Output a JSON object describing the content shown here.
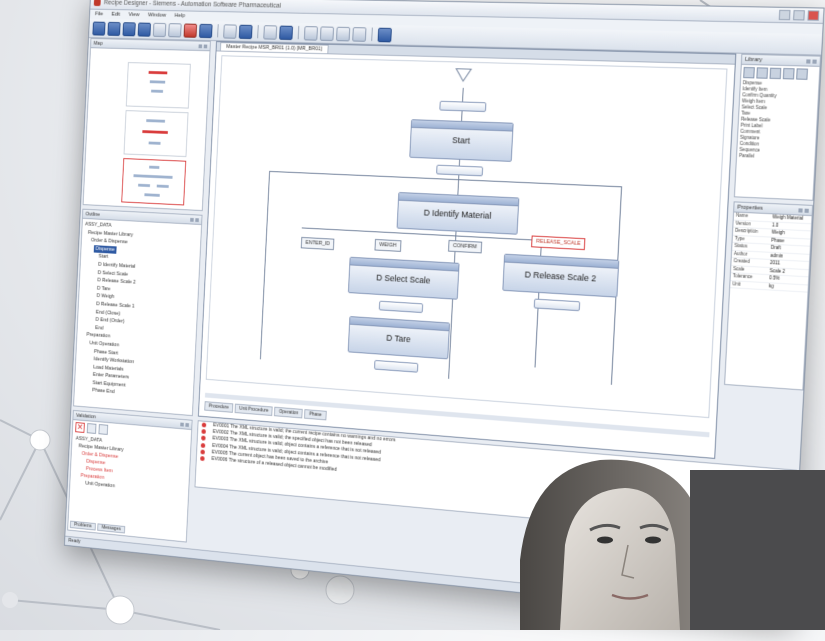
{
  "window": {
    "title": "Recipe Designer - Siemens - Automation Software Pharmaceutical"
  },
  "menu": [
    "File",
    "Edit",
    "View",
    "Window",
    "Help"
  ],
  "left": {
    "map_title": "Map",
    "outline_title": "Outline",
    "outline_items": [
      "ASSY_DATA",
      "Recipe Master Library",
      "Order & Dispense",
      "Dispense",
      "Start",
      "D Identify Material",
      "D Select Scale",
      "D Release Scale 2",
      "D Tare",
      "D Weigh",
      "D Release Scale 1",
      "End (Close)",
      "D End (Order)",
      "End",
      "Preparation",
      "Unit Operation",
      "Phase Start",
      "Identify Workstation",
      "Load Materials",
      "Enter Parameters",
      "Start Equipment",
      "Phase End"
    ]
  },
  "editor": {
    "tab_label": "Master Recipe MSR_BR01 (1.0) [MR_BR01]",
    "steps": [
      "Start",
      "D Identify Material",
      "D Select Scale",
      "D Release Scale 2",
      "D Tare"
    ],
    "actions": [
      "ENTER_ID",
      "WEIGH",
      "CONFIRM",
      "RELEASE_SCALE"
    ],
    "bottom_tabs": [
      "Procedure",
      "Unit Procedure",
      "Operation",
      "Phase"
    ]
  },
  "right": {
    "library_title": "Library",
    "library_items": [
      "Dispense",
      "Identify Item",
      "Confirm Quantity",
      "Weigh Item",
      "Select Scale",
      "Tare",
      "Release Scale",
      "Print Label",
      "Comment",
      "Signature",
      "Condition",
      "Sequence",
      "Parallel"
    ],
    "properties_title": "Properties",
    "properties": [
      {
        "k": "Name",
        "v": "Weigh Material"
      },
      {
        "k": "Version",
        "v": "1.0"
      },
      {
        "k": "Description",
        "v": "Weigh"
      },
      {
        "k": "Type",
        "v": "Phase"
      },
      {
        "k": "Status",
        "v": "Draft"
      },
      {
        "k": "Author",
        "v": "admin"
      },
      {
        "k": "Created",
        "v": "2011"
      },
      {
        "k": "Scale",
        "v": "Scale 2"
      },
      {
        "k": "Tolerance",
        "v": "0.5%"
      },
      {
        "k": "Unit",
        "v": "kg"
      }
    ]
  },
  "messages": {
    "rows": [
      "EV0001  The XML structure is valid; the current recipe contains no warnings and no errors",
      "EV0002  The XML structure is valid; the specified object has not been released",
      "EV0003  The XML structure is valid; object contains a reference that is not released",
      "EV0004  The XML structure is valid; object contains a reference that is not released",
      "EV0005  The current object has been saved to the archive",
      "EV0006  The structure of a released object cannot be modified"
    ],
    "status": "Ready"
  },
  "validation": {
    "title": "Validation",
    "items": [
      "ASSY_DATA",
      "Recipe Master Library",
      "Order & Dispense",
      "Dispense",
      "Process Item",
      "Preparation",
      "Unit Operation"
    ],
    "tabs": [
      "Problems",
      "Messages"
    ]
  }
}
